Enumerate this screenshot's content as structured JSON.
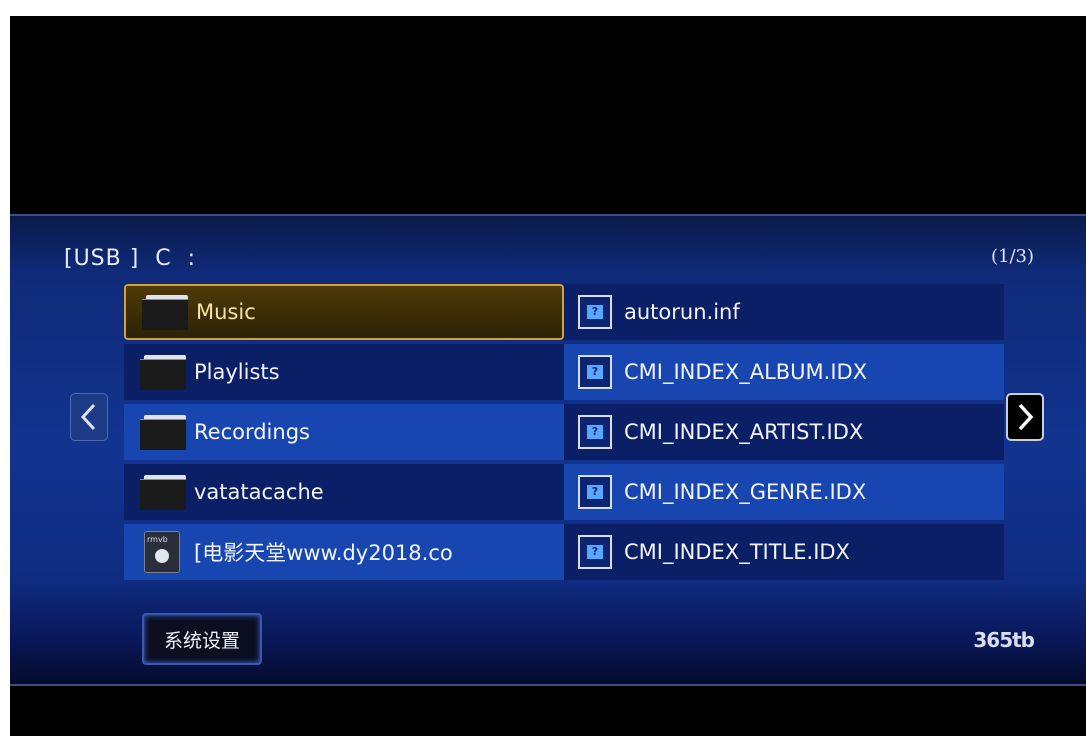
{
  "header": {
    "path": "[USB ]  C  :",
    "page_indicator": "(1/3)"
  },
  "left_list": [
    {
      "name": "Music",
      "type": "folder",
      "selected": true
    },
    {
      "name": "Playlists",
      "type": "folder"
    },
    {
      "name": "Recordings",
      "type": "folder"
    },
    {
      "name": "vatatacache",
      "type": "folder"
    },
    {
      "name": "[电影天堂www.dy2018.co",
      "type": "movie",
      "icon_tag": "rmvb"
    }
  ],
  "right_list": [
    {
      "name": "autorun.inf",
      "type": "file"
    },
    {
      "name": "CMI_INDEX_ALBUM.IDX",
      "type": "file"
    },
    {
      "name": "CMI_INDEX_ARTIST.IDX",
      "type": "file"
    },
    {
      "name": "CMI_INDEX_GENRE.IDX",
      "type": "file"
    },
    {
      "name": "CMI_INDEX_TITLE.IDX",
      "type": "file"
    }
  ],
  "footer": {
    "settings_label": "系统设置",
    "brand": "365tb"
  },
  "colors": {
    "selected_border": "#d3a03a",
    "panel_blue": "#123490"
  }
}
